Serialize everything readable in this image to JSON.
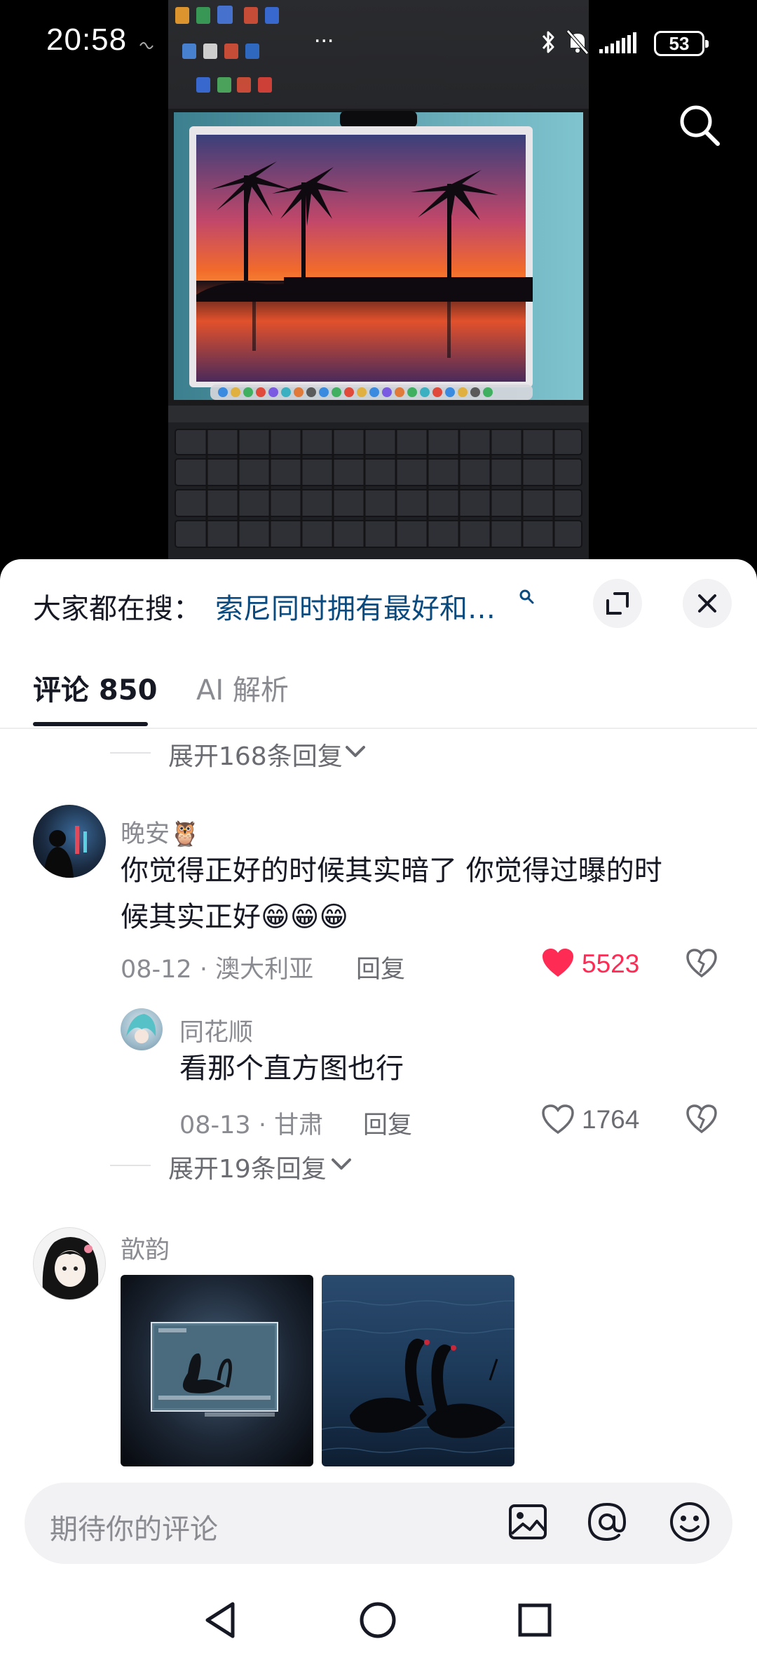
{
  "status_bar": {
    "time": "20:58",
    "overflow": "...",
    "battery": "53",
    "icons": [
      "bluetooth-icon",
      "mute-icon",
      "signal-icon",
      "battery-icon"
    ]
  },
  "video": {
    "description_icon": "search-icon"
  },
  "sheet": {
    "search_prefix": "大家都在搜：",
    "search_query": "索尼同时拥有最好和…",
    "tabs": [
      {
        "label": "评论 850",
        "active": true
      },
      {
        "label": "AI 解析",
        "active": false
      }
    ],
    "expand_top": "展开168条回复",
    "comments": [
      {
        "nickname": "晚安🦉",
        "text_line1": "你觉得正好的时候其实暗了 你觉得过曝的时",
        "text_line2": "候其实正好😁😁😁",
        "date": "08-12",
        "location": "澳大利亚",
        "reply_label": "回复",
        "likes": "5523",
        "liked": true,
        "replies": [
          {
            "nickname": "同花顺",
            "text": "看那个直方图也行",
            "date": "08-13",
            "location": "甘肃",
            "reply_label": "回复",
            "likes": "1764",
            "liked": false
          }
        ],
        "expand_label": "展开19条回复"
      },
      {
        "nickname": "歆韵",
        "images": [
          "camera-screen-black-swan-photo",
          "black-swans-on-water-photo"
        ]
      }
    ],
    "input_placeholder": "期待你的评论"
  },
  "colors": {
    "accent_like": "#fe2c55",
    "search_link": "#0a4a7e",
    "muted_text": "#8a8b91"
  },
  "nav": {
    "icons": [
      "back-triangle-icon",
      "home-circle-icon",
      "recents-square-icon"
    ]
  }
}
